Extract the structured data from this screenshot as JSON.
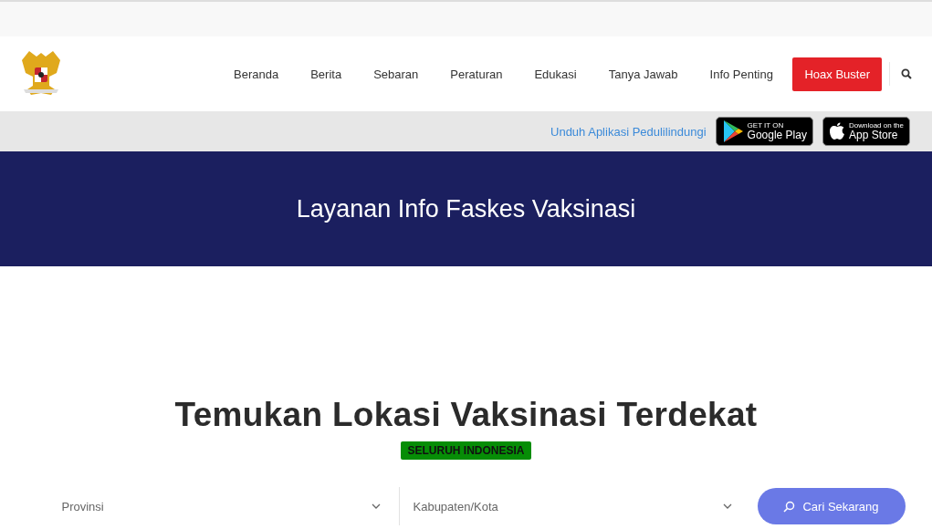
{
  "nav": {
    "items": [
      {
        "label": "Beranda",
        "kind": "link"
      },
      {
        "label": "Berita",
        "kind": "link"
      },
      {
        "label": "Sebaran",
        "kind": "link"
      },
      {
        "label": "Peraturan",
        "kind": "link"
      },
      {
        "label": "Edukasi",
        "kind": "link"
      },
      {
        "label": "Tanya Jawab",
        "kind": "link"
      },
      {
        "label": "Info Penting",
        "kind": "link"
      },
      {
        "label": "Hoax Buster",
        "kind": "highlight"
      }
    ]
  },
  "app_bar": {
    "text": "Unduh Aplikasi Pedulilindungi",
    "stores": [
      {
        "kind": "google",
        "small": "GET IT ON",
        "large": "Google Play"
      },
      {
        "kind": "apple",
        "small": "Download on the",
        "large": "App Store"
      }
    ]
  },
  "banner": {
    "title": "Layanan Info Faskes Vaksinasi"
  },
  "search": {
    "heading": "Temukan Lokasi Vaksinasi Terdekat",
    "badge": "SELURUH INDONESIA",
    "fields": [
      {
        "placeholder": "Provinsi"
      },
      {
        "placeholder": "Kabupaten/Kota"
      }
    ],
    "button": "Cari Sekarang"
  }
}
